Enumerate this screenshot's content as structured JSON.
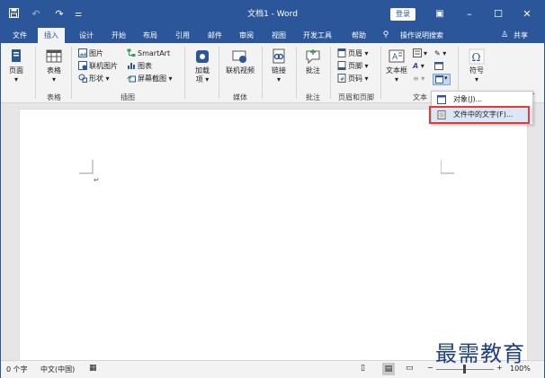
{
  "window": {
    "title": "文档1 - Word",
    "login_label": "登录"
  },
  "menu": {
    "tabs": [
      {
        "label": "文件"
      },
      {
        "label": "插入"
      },
      {
        "label": "设计"
      },
      {
        "label": "开始"
      },
      {
        "label": "布局"
      },
      {
        "label": "引用"
      },
      {
        "label": "邮件"
      },
      {
        "label": "审阅"
      },
      {
        "label": "视图"
      },
      {
        "label": "开发工具"
      },
      {
        "label": "帮助"
      }
    ],
    "search_label": "操作说明搜索",
    "share_label": "共享"
  },
  "ribbon": {
    "pages": {
      "page_label": "页面",
      "group_label": ""
    },
    "tables": {
      "table_label": "表格",
      "group_label": "表格"
    },
    "illustrations": {
      "picture": "图片",
      "online_picture": "联机图片",
      "shapes": "形状",
      "smartart": "SmartArt",
      "chart": "图表",
      "screenshot": "屏幕截图",
      "group_label": "插图"
    },
    "addins": {
      "label_line1": "加载",
      "label_line2": "项"
    },
    "media": {
      "online_video": "联机视频",
      "group_label": "媒体"
    },
    "links": {
      "label": "链接"
    },
    "comments": {
      "label": "批注",
      "group_label": "批注"
    },
    "header_footer": {
      "header": "页眉",
      "footer": "页脚",
      "page_number": "页码",
      "group_label": "页眉和页脚"
    },
    "text": {
      "textbox": "文本框",
      "group_label": "文本"
    },
    "symbols": {
      "symbol": "符号"
    }
  },
  "object_menu": {
    "items": [
      {
        "label": "对象(J)..."
      },
      {
        "label": "文件中的文字(F)..."
      }
    ]
  },
  "status": {
    "word_count": "0 个字",
    "language": "中文(中国)",
    "zoom": "100%"
  },
  "watermark": {
    "text": "最需教育"
  },
  "colors": {
    "brand": "#2b579a",
    "highlight": "#e23b3b"
  }
}
